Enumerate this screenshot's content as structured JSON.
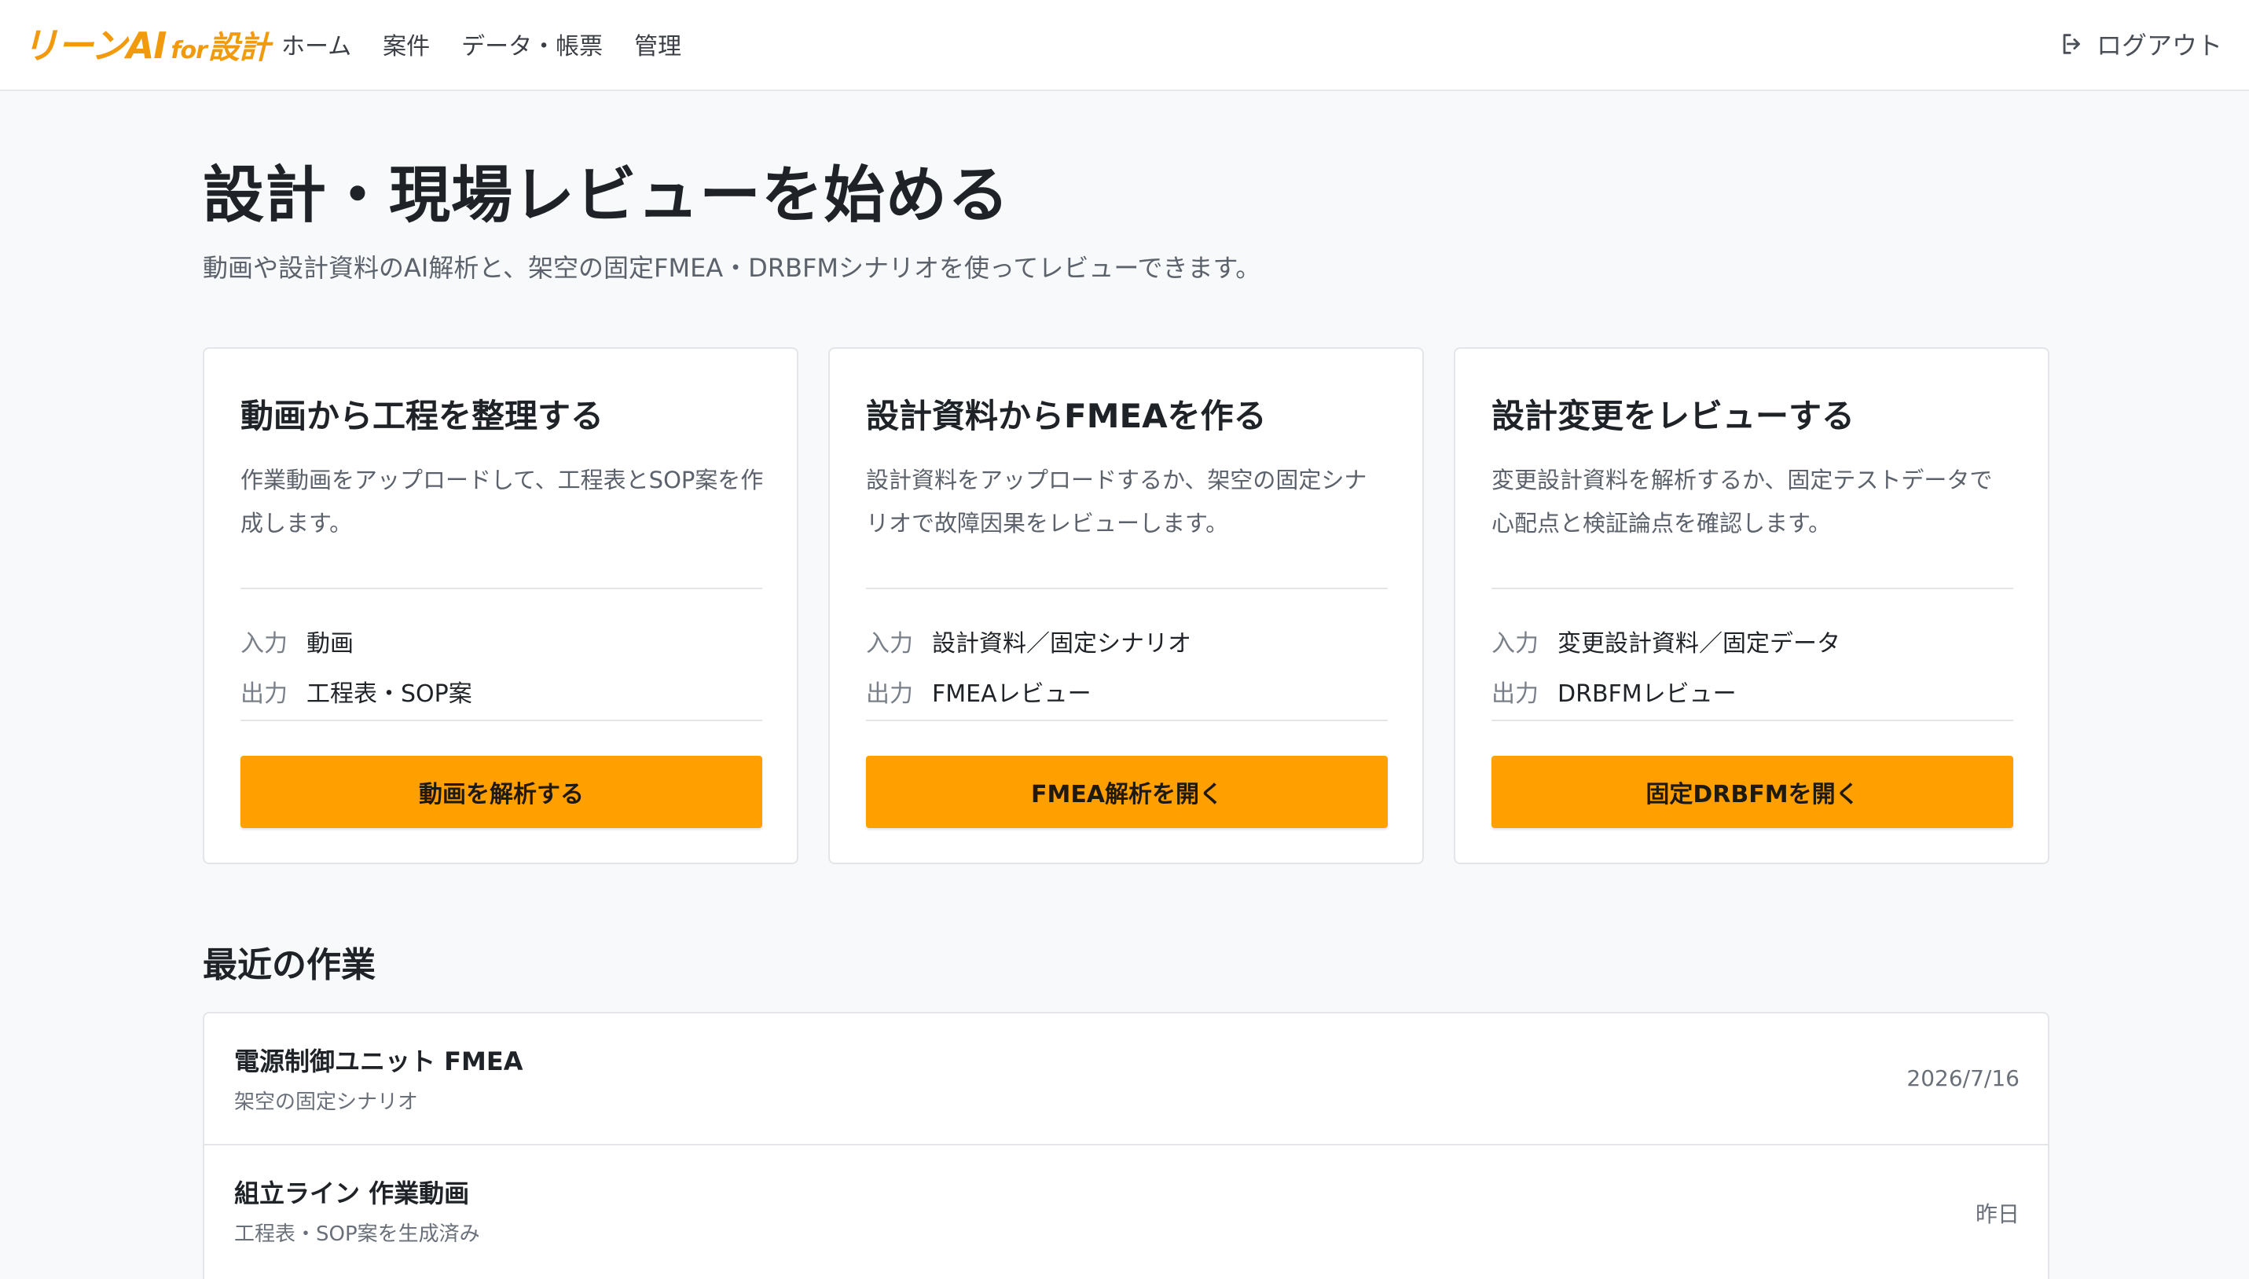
{
  "header": {
    "logo": {
      "part1": "リーンAI",
      "part2": "for",
      "part3": "設計"
    },
    "nav": [
      {
        "label": "ホーム"
      },
      {
        "label": "案件"
      },
      {
        "label": "データ・帳票"
      },
      {
        "label": "管理"
      }
    ],
    "logout_label": "ログアウト"
  },
  "hero": {
    "title": "設計・現場レビューを始める",
    "subtitle": "動画や設計資料のAI解析と、架空の固定FMEA・DRBFMシナリオを使ってレビューできます。"
  },
  "cards": [
    {
      "title": "動画から工程を整理する",
      "description": "作業動画をアップロードして、工程表とSOP案を作成します。",
      "input_label": "入力",
      "input_value": "動画",
      "output_label": "出力",
      "output_value": "工程表・SOP案",
      "button_label": "動画を解析する"
    },
    {
      "title": "設計資料からFMEAを作る",
      "description": "設計資料をアップロードするか、架空の固定シナリオで故障因果をレビューします。",
      "input_label": "入力",
      "input_value": "設計資料／固定シナリオ",
      "output_label": "出力",
      "output_value": "FMEAレビュー",
      "button_label": "FMEA解析を開く"
    },
    {
      "title": "設計変更をレビューする",
      "description": "変更設計資料を解析するか、固定テストデータで心配点と検証論点を確認します。",
      "input_label": "入力",
      "input_value": "変更設計資料／固定データ",
      "output_label": "出力",
      "output_value": "DRBFMレビュー",
      "button_label": "固定DRBFMを開く"
    }
  ],
  "recent": {
    "title": "最近の作業",
    "items": [
      {
        "title": "電源制御ユニット FMEA",
        "subtitle": "架空の固定シナリオ",
        "date": "2026/7/16"
      },
      {
        "title": "組立ライン 作業動画",
        "subtitle": "工程表・SOP案を生成済み",
        "date": "昨日"
      }
    ]
  },
  "colors": {
    "accent": "#ff9f00",
    "logo": "#f29a0e",
    "background": "#f8f9fa"
  }
}
